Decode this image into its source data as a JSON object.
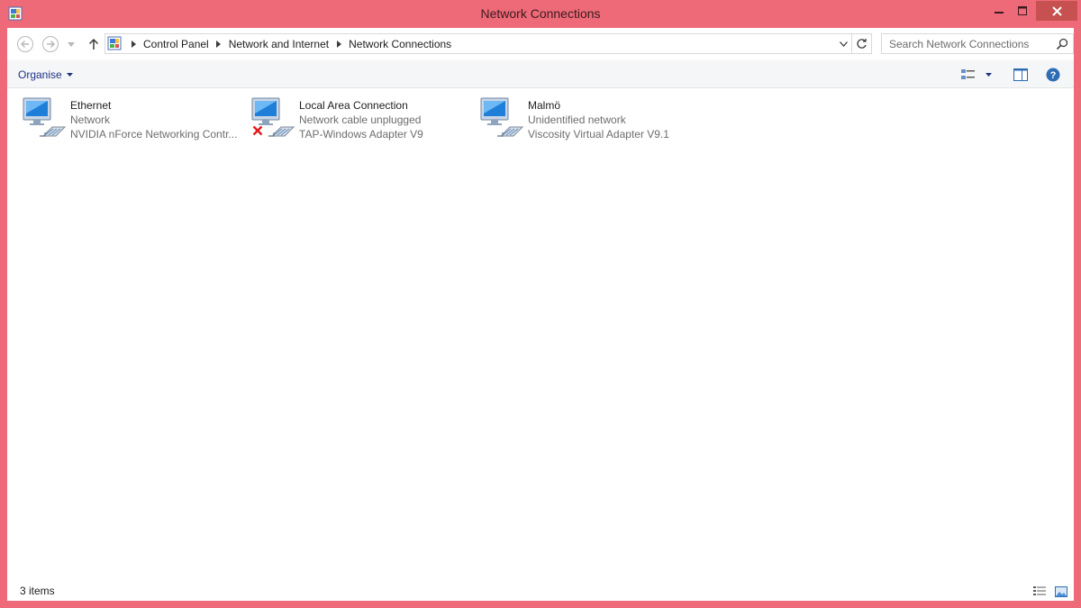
{
  "window": {
    "title": "Network Connections",
    "frame_color": "#ee6a78",
    "close_color": "#c75050"
  },
  "titlebar": {
    "app_icon": "control-panel-icon",
    "minimize_icon": "minimize-icon",
    "maximize_icon": "maximize-icon",
    "close_icon": "close-icon"
  },
  "nav": {
    "back_icon": "back-arrow-icon",
    "forward_icon": "forward-arrow-icon",
    "recent_icon": "chevron-down-icon",
    "up_icon": "up-arrow-icon",
    "breadcrumbs": [
      "Control Panel",
      "Network and Internet",
      "Network Connections"
    ],
    "refresh_icon": "refresh-icon"
  },
  "search": {
    "placeholder": "Search Network Connections",
    "value": ""
  },
  "commandbar": {
    "organise_label": "Organise"
  },
  "connections": [
    {
      "name": "Ethernet",
      "status": "Network",
      "adapter": "NVIDIA nForce Networking Contr...",
      "disconnected": false
    },
    {
      "name": "Local Area Connection",
      "status": "Network cable unplugged",
      "adapter": "TAP-Windows Adapter V9",
      "disconnected": true
    },
    {
      "name": "Malmö",
      "status": "Unidentified network",
      "adapter": "Viscosity Virtual Adapter V9.1",
      "disconnected": false
    }
  ],
  "statusbar": {
    "item_count": "3 items"
  }
}
